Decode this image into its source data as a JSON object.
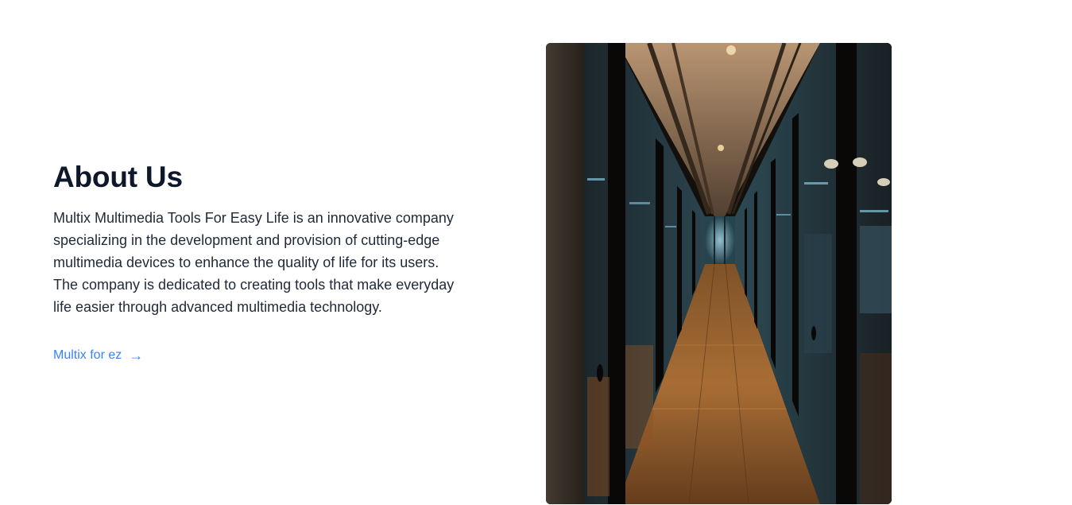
{
  "about": {
    "title": "About Us",
    "description": "Multix Multimedia Tools For Easy Life is an innovative company specializing in the development and provision of cutting-edge multimedia devices to enhance the quality of life for its users. The company is dedicated to creating tools that make everyday life easier through advanced multimedia technology.",
    "link_label": "Multix for ez",
    "link_icon": "arrow-right-icon"
  },
  "image": {
    "subject": "office-corridor-photo"
  },
  "colors": {
    "title": "#0f172a",
    "body_text": "#1f2937",
    "link": "#3b82f6",
    "background": "#ffffff"
  }
}
